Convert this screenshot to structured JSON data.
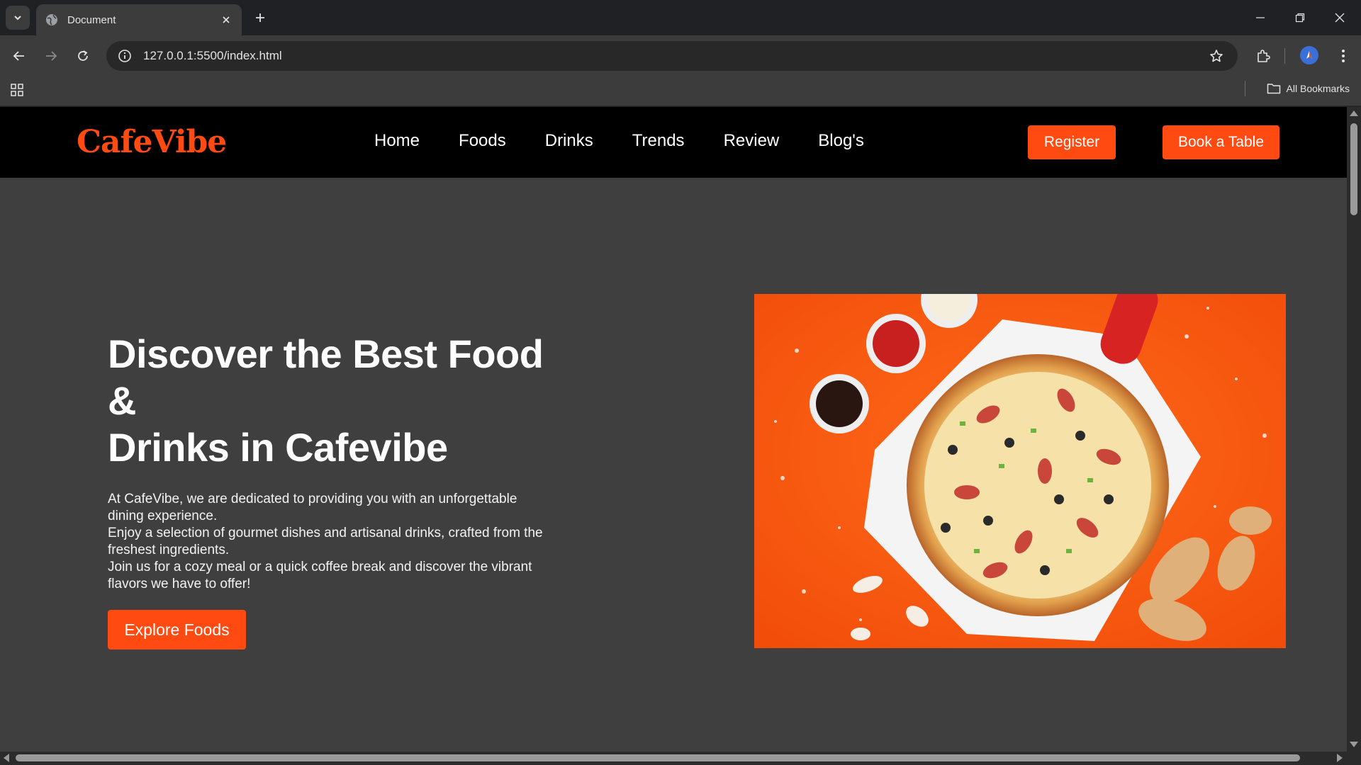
{
  "browser": {
    "tab_title": "Document",
    "url": "127.0.0.1:5500/index.html",
    "bookmarks_label": "All Bookmarks"
  },
  "site": {
    "logo": "CafeVibe",
    "menu": [
      "Home",
      "Foods",
      "Drinks",
      "Trends",
      "Review",
      "Blog's"
    ],
    "register_label": "Register",
    "book_label": "Book a Table"
  },
  "hero": {
    "title_lines": [
      "Discover the Best Food",
      "&",
      "Drinks in Cafevibe"
    ],
    "paragraphs": [
      "At CafeVibe, we are dedicated to providing you with an unforgettable dining experience.",
      "Enjoy a selection of gourmet dishes and artisanal drinks, crafted from the freshest ingredients.",
      "Join us for a cozy meal or a quick coffee break and discover the vibrant flavors we have to offer!"
    ],
    "cta_label": "Explore Foods"
  },
  "colors": {
    "accent": "#ff4a12",
    "nav_bg": "#000000",
    "page_bg": "#3f3f3f",
    "image_bg": "#ff5a0f"
  },
  "icons": [
    "tab-search-icon",
    "globe-icon",
    "close-icon",
    "plus-icon",
    "minimize-icon",
    "restore-icon",
    "back-icon",
    "forward-icon",
    "reload-icon",
    "info-icon",
    "star-icon",
    "extensions-icon",
    "menu-dots-icon",
    "apps-icon",
    "folder-icon"
  ]
}
